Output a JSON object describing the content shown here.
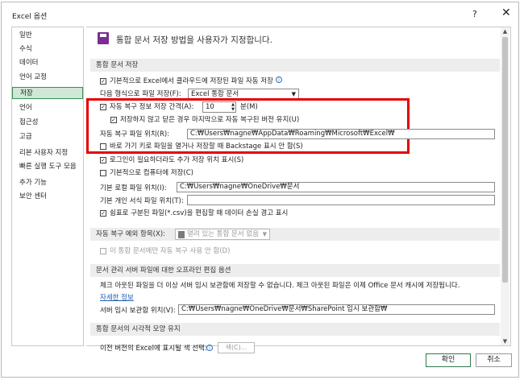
{
  "window": {
    "title": "Excel 옵션",
    "help_label": "?",
    "close_label": "✕"
  },
  "sidebar": {
    "items": [
      {
        "label": "일반"
      },
      {
        "label": "수식"
      },
      {
        "label": "데이터"
      },
      {
        "label": "언어 교정"
      },
      {
        "label": "저장",
        "selected": true
      },
      {
        "label": "언어"
      },
      {
        "label": "접근성"
      },
      {
        "label": "고급"
      },
      {
        "label": "리본 사용자 지정"
      },
      {
        "label": "빠른 실행 도구 모음"
      },
      {
        "label": "추가 기능"
      },
      {
        "label": "보안 센터"
      }
    ]
  },
  "header": {
    "title": "통합 문서 저장 방법을 사용자가 지정합니다."
  },
  "save_section": {
    "title": "통합 문서 저장",
    "autosave_cloud": {
      "label": "기본적으로 Excel에서 클라우드에 저장된 파일 자동 저장",
      "checked": true
    },
    "format_label": "다음 형식으로 파일 저장(F):",
    "format_value": "Excel 통합 문서",
    "autorecover": {
      "label": "자동 복구 정보 저장 간격(A):",
      "checked": true,
      "value": "10",
      "unit": "분(M)"
    },
    "keep_last": {
      "label": "저장하지 않고 닫은 경우 마지막으로 자동 복구된 버전 유지(U)",
      "checked": true
    },
    "recover_path_label": "자동 복구 파일 위치(R):",
    "recover_path_value": "C:₩Users₩nagne₩AppData₩Roaming₩Microsoft₩Excel₩",
    "no_backstage": {
      "label": "바로 가기 키로 파일을 열거나 저장할 때 Backstage 표시 안 함(S)",
      "checked": false
    },
    "show_extra": {
      "label": "로그인이 필요하더라도 추가 저장 위치 표시(S)",
      "checked": true
    },
    "save_local": {
      "label": "기본적으로 컴퓨터에 저장(C)",
      "checked": false
    },
    "local_path_label": "기본 로컬 파일 위치(I):",
    "local_path_value": "C:₩Users₩nagne₩OneDrive₩문서",
    "template_label": "기본 개인 서식 파일 위치(T):",
    "template_value": "",
    "csv_warning": {
      "label": "쉼표로 구분된 파일(*.csv)을 편집할 때 데이터 손실 경고 표시",
      "checked": true
    }
  },
  "exceptions_section": {
    "label": "자동 복구 예외 항목(X):",
    "dropdown_value": "열려 있는 통합 문서 없음",
    "disable_only": {
      "label": "이 통합 문서에만 자동 복구 사용 안 함(D)",
      "checked": false
    }
  },
  "offline_section": {
    "title": "문서 관리 서버 파일에 대한 오프라인 편집 옵션",
    "description": "체크 아웃된 파일을 더 이상 서버 임시 보관함에 저장할 수 없습니다. 체크 아웃된 파일은 이제 Office 문서 캐시에 저장됩니다.",
    "more_link": "자세한 정보",
    "drafts_label": "서버 임시 보관함 위치(V):",
    "drafts_value": "C:₩Users₩nagne₩OneDrive₩문서₩SharePoint 임시 보관함₩"
  },
  "appearance_section": {
    "title": "통합 문서의 시각적 모양 유지",
    "colors_label": "이전 버전의 Excel에 표시될 색 선택:",
    "colors_button": "색(C)..."
  },
  "footer": {
    "ok": "확인",
    "cancel": "취소"
  }
}
